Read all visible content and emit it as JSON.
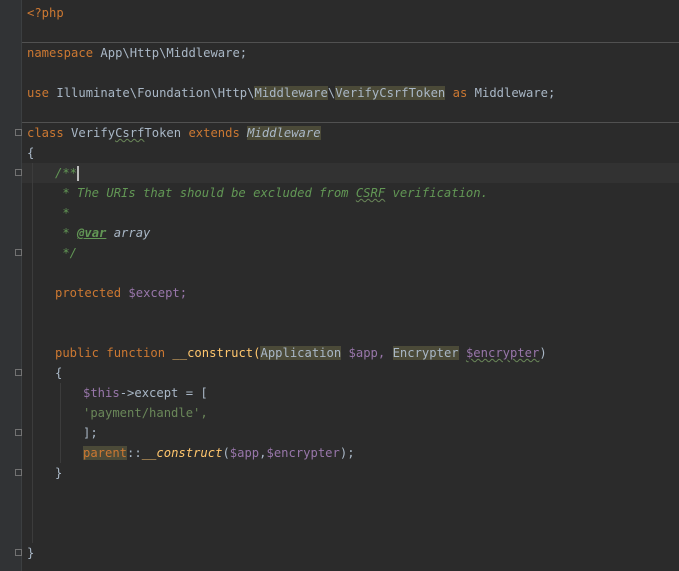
{
  "code": {
    "open_tag": "<?php",
    "ns_keyword": "namespace",
    "ns_name": "App\\Http\\Middleware;",
    "use_keyword": "use",
    "use_part1": "Illuminate\\Foundation\\Http\\",
    "use_part2": "Middleware",
    "use_sep": "\\",
    "use_part3": "VerifyCsrfToken",
    "as_keyword": "as",
    "use_alias": "Middleware;",
    "class_keyword": "class",
    "class_name_1": "Verify",
    "class_name_2": "Csrf",
    "class_name_3": "Token",
    "extends_keyword": "extends",
    "parent_class": "Middleware",
    "brace_open": "{",
    "doc_open": "/**",
    "doc_line1_a": " * The URIs that should be excluded from ",
    "doc_line1_b": "CSRF",
    "doc_line1_c": " verification.",
    "doc_line2": " *",
    "doc_line3_a": " * ",
    "doc_line3_tag": "@var",
    "doc_line3_b": " array",
    "doc_close": " */",
    "protected_keyword": "protected",
    "except_var": "$except;",
    "public_keyword": "public",
    "function_keyword": "function",
    "construct_name": "__construct(",
    "param_type1": "Application",
    "param_var1": "$app,",
    "param_type2": "Encrypter",
    "param_var2": "$encrypter",
    "paren_close": ")",
    "method_brace_open": "{",
    "this_var": "$this",
    "except_assign": "->except = [",
    "array_value": "'payment/handle',",
    "array_close": "];",
    "parent_keyword": "parent",
    "static_call": "::",
    "parent_construct": "__construct",
    "parent_args_open": "(",
    "parent_arg1": "$app",
    "parent_comma": ",",
    "parent_arg2": "$encrypter",
    "parent_args_close": ");",
    "method_brace_close": "}",
    "class_brace_close": "}"
  },
  "colors": {
    "background": "#2b2b2b",
    "gutter": "#313335",
    "keyword": "#cc7832",
    "variable": "#9876aa",
    "string": "#6a8759",
    "doc_comment": "#629755",
    "function": "#ffc66d",
    "text": "#a9b7c6",
    "usage_highlight": "#4b4a38"
  }
}
